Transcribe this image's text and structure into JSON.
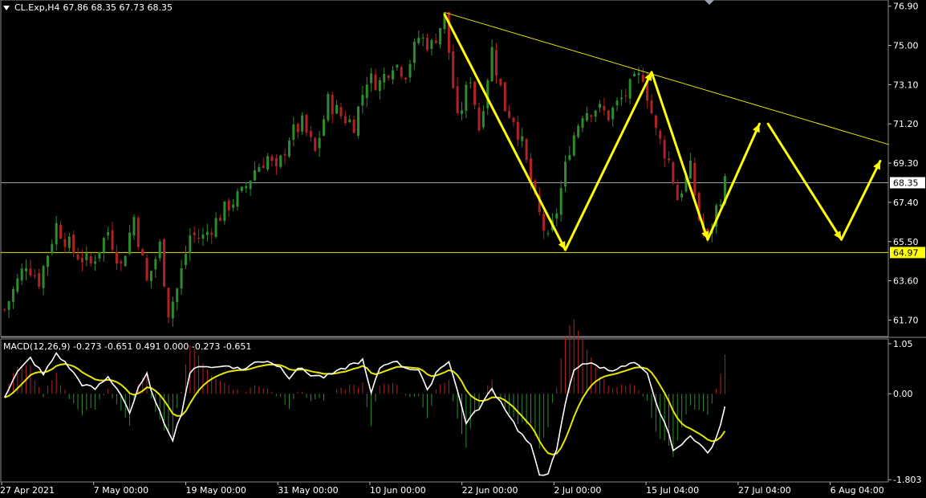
{
  "header": {
    "symbol": "CL.Exp,H4",
    "ohlc": "67.86 68.35 67.73 68.35"
  },
  "macd": {
    "label": "MACD(12,26,9) -0.273 -0.651 0.491 0.000 -0.273 -0.651"
  },
  "colors": {
    "background": "#000000",
    "bull_candle": "#2e8b2e",
    "bear_candle": "#b22222",
    "trendline": "#e6e600",
    "arrow": "#ffff00",
    "macd_line": "#ffffff",
    "signal_line": "#e6e600",
    "price_tag_current": "#ffffff",
    "price_tag_support": "#ffff00"
  },
  "chart_data": [
    {
      "type": "candlestick",
      "symbol": "CL.Exp",
      "timeframe": "H4",
      "y_ticks": [
        "76.90",
        "75.00",
        "73.10",
        "71.20",
        "69.30",
        "67.40",
        "65.50",
        "63.60",
        "61.70"
      ],
      "ylim": [
        60.9,
        77.2
      ],
      "x_ticks": [
        "27 Apr 2021",
        "7 May 00:00",
        "19 May 00:00",
        "31 May 00:00",
        "10 Jun 00:00",
        "22 Jun 00:00",
        "2 Jul 00:00",
        "15 Jul 04:00",
        "27 Jul 04:00",
        "6 Aug 04:00"
      ],
      "current_price": "68.35",
      "support_level": "64.97",
      "price_path": [
        [
          0,
          62.2
        ],
        [
          5,
          64.5
        ],
        [
          8,
          63.6
        ],
        [
          12,
          66.3
        ],
        [
          16,
          65.0
        ],
        [
          20,
          64.4
        ],
        [
          24,
          66.0
        ],
        [
          27,
          64.3
        ],
        [
          30,
          66.7
        ],
        [
          33,
          63.5
        ],
        [
          36,
          65.3
        ],
        [
          38,
          62.1
        ],
        [
          40,
          63.2
        ],
        [
          43,
          65.8
        ],
        [
          46,
          65.7
        ],
        [
          49,
          66.5
        ],
        [
          52,
          67.3
        ],
        [
          55,
          67.8
        ],
        [
          58,
          69.0
        ],
        [
          61,
          69.6
        ],
        [
          63,
          68.8
        ],
        [
          66,
          70.6
        ],
        [
          69,
          71.2
        ],
        [
          72,
          69.8
        ],
        [
          75,
          72.3
        ],
        [
          78,
          71.6
        ],
        [
          81,
          71.2
        ],
        [
          84,
          73.4
        ],
        [
          87,
          73.2
        ],
        [
          90,
          74.2
        ],
        [
          93,
          73.7
        ],
        [
          96,
          75.4
        ],
        [
          99,
          75.0
        ],
        [
          102,
          76.4
        ],
        [
          105,
          71.3
        ],
        [
          108,
          73.5
        ],
        [
          110,
          71.0
        ],
        [
          113,
          74.8
        ],
        [
          116,
          72.0
        ],
        [
          118,
          71.5
        ],
        [
          120,
          70.2
        ],
        [
          123,
          67.4
        ],
        [
          126,
          65.5
        ],
        [
          128,
          67.0
        ],
        [
          131,
          70.1
        ],
        [
          134,
          71.8
        ],
        [
          137,
          72.0
        ],
        [
          140,
          71.6
        ],
        [
          143,
          72.4
        ],
        [
          146,
          73.2
        ],
        [
          148,
          73.6
        ],
        [
          151,
          70.8
        ],
        [
          154,
          69.4
        ],
        [
          156,
          67.6
        ],
        [
          159,
          69.0
        ],
        [
          161,
          66.6
        ],
        [
          163,
          65.5
        ],
        [
          165,
          67.1
        ],
        [
          167,
          68.35
        ]
      ],
      "projection_arrows": [
        [
          102,
          76.5,
          130,
          65.1
        ],
        [
          130,
          65.1,
          150,
          73.7
        ],
        [
          150,
          73.7,
          163,
          65.6
        ],
        [
          163,
          65.6,
          175,
          71.2
        ],
        [
          177,
          71.2,
          194,
          65.6
        ],
        [
          194,
          65.6,
          203,
          69.4
        ]
      ],
      "trendline": [
        [
          102,
          76.6
        ],
        [
          205,
          70.2
        ]
      ],
      "n_bars": 205
    },
    {
      "type": "macd",
      "name": "MACD(12,26,9)",
      "y_ticks": [
        "1.05",
        "0.00",
        "-1.803"
      ],
      "ylim": [
        -1.85,
        1.15
      ],
      "macd_path": [
        [
          0,
          -0.05
        ],
        [
          3,
          0.45
        ],
        [
          6,
          0.75
        ],
        [
          9,
          0.4
        ],
        [
          12,
          0.85
        ],
        [
          15,
          0.55
        ],
        [
          18,
          0.2
        ],
        [
          21,
          0.1
        ],
        [
          24,
          0.35
        ],
        [
          27,
          0.0
        ],
        [
          29,
          -0.4
        ],
        [
          31,
          0.1
        ],
        [
          33,
          0.4
        ],
        [
          35,
          -0.2
        ],
        [
          37,
          -0.6
        ],
        [
          39,
          -0.95
        ],
        [
          41,
          -0.4
        ],
        [
          43,
          0.45
        ],
        [
          46,
          0.6
        ],
        [
          49,
          0.55
        ],
        [
          52,
          0.6
        ],
        [
          55,
          0.5
        ],
        [
          58,
          0.65
        ],
        [
          61,
          0.7
        ],
        [
          64,
          0.55
        ],
        [
          66,
          0.35
        ],
        [
          68,
          0.55
        ],
        [
          71,
          0.4
        ],
        [
          74,
          0.35
        ],
        [
          77,
          0.45
        ],
        [
          80,
          0.6
        ],
        [
          83,
          0.7
        ],
        [
          85,
          0.0
        ],
        [
          87,
          0.55
        ],
        [
          90,
          0.7
        ],
        [
          93,
          0.55
        ],
        [
          96,
          0.5
        ],
        [
          98,
          0.05
        ],
        [
          100,
          0.45
        ],
        [
          103,
          0.7
        ],
        [
          105,
          0.05
        ],
        [
          107,
          -0.6
        ],
        [
          110,
          -0.3
        ],
        [
          113,
          0.1
        ],
        [
          116,
          -0.3
        ],
        [
          119,
          -0.75
        ],
        [
          122,
          -1.1
        ],
        [
          124,
          -1.7
        ],
        [
          126,
          -1.65
        ],
        [
          128,
          -1.2
        ],
        [
          130,
          -0.2
        ],
        [
          132,
          0.5
        ],
        [
          134,
          0.65
        ],
        [
          137,
          0.6
        ],
        [
          140,
          0.5
        ],
        [
          143,
          0.55
        ],
        [
          146,
          0.65
        ],
        [
          149,
          0.4
        ],
        [
          151,
          -0.2
        ],
        [
          153,
          -0.6
        ],
        [
          155,
          -1.15
        ],
        [
          157,
          -1.1
        ],
        [
          159,
          -0.85
        ],
        [
          161,
          -1.05
        ],
        [
          163,
          -1.25
        ],
        [
          165,
          -0.95
        ],
        [
          167,
          -0.3
        ]
      ]
    }
  ]
}
